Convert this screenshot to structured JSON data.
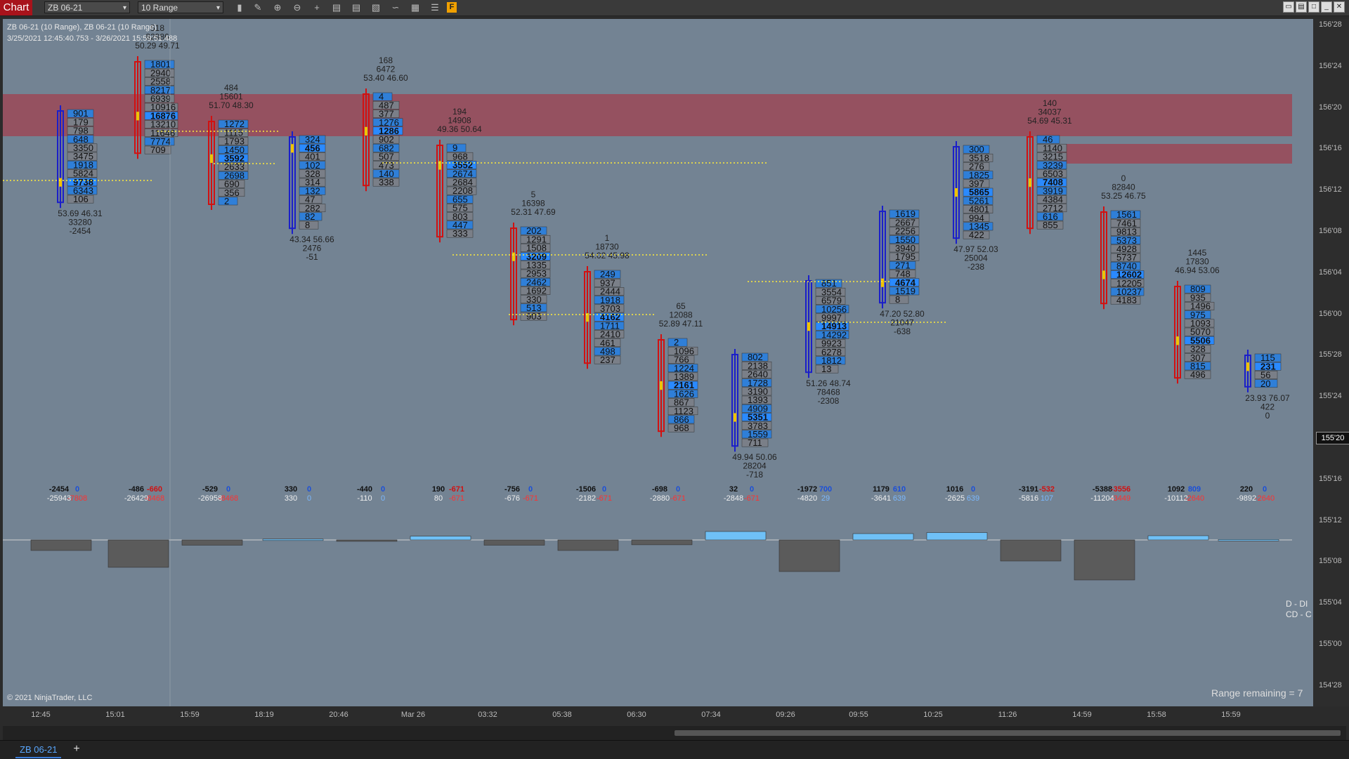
{
  "app": {
    "badge": "Chart"
  },
  "toolbar": {
    "instrument": "ZB 06-21",
    "interval": "10 Range",
    "icons": [
      "bar-type-icon",
      "draw-tool-icon",
      "zoom-in-icon",
      "zoom-out-icon",
      "crosshair-icon",
      "properties-icon",
      "templates-icon",
      "strategy-icon",
      "indicator-icon",
      "chart-trader-icon",
      "data-box-icon",
      "f-icon"
    ],
    "f_label": "F"
  },
  "window_controls": [
    "restore",
    "tile",
    "maximize",
    "minimize",
    "close"
  ],
  "chart": {
    "title": "ZB 06-21 (10 Range), ZB 06-21 (10 Range)",
    "range": "3/25/2021 12:45:40.753 - 3/26/2021 15:59:51.488",
    "copyright": "© 2021 NinjaTrader, LLC",
    "range_remaining": "Range remaining = 7",
    "delta_labels": [
      "D - DI",
      "CD - C"
    ],
    "colors": {
      "background": "#738393",
      "zone": "#a0404f",
      "up_candle": "#1b1fc9",
      "down_candle": "#d11111",
      "vpoc": "#2a8aff",
      "poc_text": "#ffffff",
      "level_line": "#ffeb3b"
    }
  },
  "price_axis": [
    "156'28",
    "156'24",
    "156'20",
    "156'16",
    "156'12",
    "156'08",
    "156'04",
    "156'00",
    "155'28",
    "155'24",
    "155'20",
    "155'16",
    "155'12",
    "155'08",
    "155'04",
    "155'00",
    "154'28"
  ],
  "cursor_price": "155'20",
  "time_axis": [
    "12:45",
    "15:01",
    "15:59",
    "18:19",
    "20:46",
    "Mar 26",
    "03:32",
    "05:38",
    "06:30",
    "07:34",
    "09:26",
    "09:55",
    "10:25",
    "11:26",
    "14:59",
    "15:58",
    "15:59"
  ],
  "tab": {
    "label": "ZB 06-21",
    "add_label": "+"
  },
  "bars": [
    {
      "hdr": [
        "",
        "",
        ""
      ],
      "vols": [
        "901",
        "179",
        "798",
        "648",
        "3350",
        "3475",
        "1918",
        "5824",
        "9738",
        "6343",
        "106"
      ],
      "poc": 8,
      "ftr": [
        "53.69  46.31",
        "33280",
        "-2454"
      ],
      "up": true
    },
    {
      "hdr": [
        "518",
        "82986",
        "50.29  49.71"
      ],
      "vols": [
        "1801",
        "2940",
        "2558",
        "8217",
        "6939",
        "10916",
        "16876",
        "13210",
        "11646",
        "7774",
        "709"
      ],
      "poc": 6,
      "ftr": [
        "",
        "",
        ""
      ],
      "up": false
    },
    {
      "hdr": [
        "484",
        "15601",
        "51.70  48.30"
      ],
      "vols": [
        "1272",
        "1115",
        "1793",
        "1450",
        "3592",
        "2633",
        "2698",
        "690",
        "356",
        "2"
      ],
      "poc": 4,
      "ftr": [
        "",
        "",
        ""
      ],
      "up": false
    },
    {
      "hdr": [
        "",
        "",
        ""
      ],
      "vols": [
        "324",
        "456",
        "401",
        "102",
        "328",
        "314",
        "132",
        "47",
        "282",
        "82",
        "8"
      ],
      "poc": 1,
      "ftr": [
        "43.34  56.66",
        "2476",
        "-51"
      ],
      "up": true
    },
    {
      "hdr": [
        "168",
        "6472",
        "53.40  46.60"
      ],
      "vols": [
        "4",
        "487",
        "377",
        "1276",
        "1286",
        "902",
        "682",
        "507",
        "473",
        "140",
        "338"
      ],
      "poc": 4,
      "ftr": [
        "",
        "",
        ""
      ],
      "up": false
    },
    {
      "hdr": [
        "194",
        "14908",
        "49.36  50.64"
      ],
      "vols": [
        "9",
        "968",
        "3552",
        "2674",
        "2684",
        "2208",
        "655",
        "575",
        "803",
        "447",
        "333"
      ],
      "poc": 2,
      "ftr": [
        "",
        "",
        ""
      ],
      "up": false
    },
    {
      "hdr": [
        "5",
        "16398",
        "52.31  47.69"
      ],
      "vols": [
        "202",
        "1291",
        "1508",
        "3209",
        "1335",
        "2953",
        "2462",
        "1692",
        "330",
        "513",
        "903"
      ],
      "poc": 3,
      "ftr": [
        "",
        "",
        ""
      ],
      "up": false
    },
    {
      "hdr": [
        "1",
        "18730",
        "54.02  45.98"
      ],
      "vols": [
        "249",
        "937",
        "2444",
        "1918",
        "3703",
        "4162",
        "1711",
        "2410",
        "461",
        "498",
        "237"
      ],
      "poc": 5,
      "ftr": [
        "",
        "",
        ""
      ],
      "up": false
    },
    {
      "hdr": [
        "65",
        "12088",
        "52.89  47.11"
      ],
      "vols": [
        "2",
        "1096",
        "766",
        "1224",
        "1389",
        "2161",
        "1626",
        "867",
        "1123",
        "866",
        "968"
      ],
      "poc": 5,
      "ftr": [
        "",
        "",
        ""
      ],
      "up": false
    },
    {
      "hdr": [
        "",
        "",
        ""
      ],
      "vols": [
        "802",
        "2138",
        "2640",
        "1728",
        "3190",
        "1393",
        "4909",
        "5351",
        "3783",
        "1559",
        "711"
      ],
      "poc": 7,
      "ftr": [
        "49.94  50.06",
        "28204",
        "-718"
      ],
      "up": true
    },
    {
      "hdr": [
        "",
        "",
        ""
      ],
      "vols": [
        "851",
        "3554",
        "6579",
        "10256",
        "9997",
        "14913",
        "14292",
        "9923",
        "6278",
        "1812",
        "13"
      ],
      "poc": 5,
      "ftr": [
        "51.26  48.74",
        "78468",
        "-2308"
      ],
      "up": true
    },
    {
      "hdr": [
        "",
        "",
        ""
      ],
      "vols": [
        "1619",
        "2667",
        "2256",
        "1550",
        "3940",
        "1795",
        "271",
        "748",
        "4674",
        "1519",
        "8"
      ],
      "poc": 8,
      "ftr": [
        "47.20  52.80",
        "21047",
        "-638"
      ],
      "up": true
    },
    {
      "hdr": [
        "",
        "",
        ""
      ],
      "vols": [
        "300",
        "3518",
        "276",
        "1825",
        "397",
        "5865",
        "5261",
        "4801",
        "994",
        "1345",
        "422"
      ],
      "poc": 5,
      "ftr": [
        "47.97  52.03",
        "25004",
        "-238"
      ],
      "up": true
    },
    {
      "hdr": [
        "140",
        "34037",
        "54.69  45.31"
      ],
      "vols": [
        "46",
        "1140",
        "3215",
        "3239",
        "6503",
        "7408",
        "3919",
        "4384",
        "2712",
        "616",
        "855"
      ],
      "poc": 5,
      "ftr": [
        "",
        "",
        ""
      ],
      "up": false
    },
    {
      "hdr": [
        "0",
        "82840",
        "53.25  46.75"
      ],
      "vols": [
        "1561",
        "7461",
        "9813",
        "5373",
        "4928",
        "5737",
        "8740",
        "12602",
        "12205",
        "10237",
        "4183"
      ],
      "poc": 7,
      "ftr": [
        "",
        "",
        ""
      ],
      "up": false
    },
    {
      "hdr": [
        "1445",
        "17830",
        "46.94  53.06"
      ],
      "vols": [
        "809",
        "935",
        "1496",
        "975",
        "1093",
        "5070",
        "5506",
        "328",
        "307",
        "815",
        "496"
      ],
      "poc": 6,
      "ftr": [
        "",
        "",
        ""
      ],
      "up": false
    },
    {
      "hdr": [
        "",
        "",
        ""
      ],
      "vols": [
        "115",
        "231",
        "56",
        "20"
      ],
      "poc": 1,
      "ftr": [
        "23.93  76.07",
        "422",
        "0"
      ],
      "up": true
    }
  ],
  "delta": [
    {
      "d": "-2454",
      "di": "0",
      "cd": "-25943",
      "c": "-7808",
      "val": -0.5
    },
    {
      "d": "-486",
      "di": "-660",
      "cd": "-26429",
      "c": "-8468",
      "val": -1.3
    },
    {
      "d": "-529",
      "di": "0",
      "cd": "-26958",
      "c": "-8468",
      "val": -0.25
    },
    {
      "d": "330",
      "di": "0",
      "cd": "330",
      "c": "0",
      "val": 0.04
    },
    {
      "d": "-440",
      "di": "0",
      "cd": "-110",
      "c": "0",
      "val": -0.06
    },
    {
      "d": "190",
      "di": "-671",
      "cd": "80",
      "c": "-671",
      "val": 0.18
    },
    {
      "d": "-756",
      "di": "0",
      "cd": "-676",
      "c": "-671",
      "val": -0.25
    },
    {
      "d": "-1506",
      "di": "0",
      "cd": "-2182",
      "c": "-671",
      "val": -0.5
    },
    {
      "d": "-698",
      "di": "0",
      "cd": "-2880",
      "c": "-671",
      "val": -0.23
    },
    {
      "d": "32",
      "di": "0",
      "cd": "-2848",
      "c": "-671",
      "val": 0.4
    },
    {
      "d": "-1972",
      "di": "700",
      "cd": "-4820",
      "c": "29",
      "val": -1.5
    },
    {
      "d": "1179",
      "di": "610",
      "cd": "-3641",
      "c": "639",
      "val": 0.3
    },
    {
      "d": "1016",
      "di": "0",
      "cd": "-2625",
      "c": "639",
      "val": 0.35
    },
    {
      "d": "-3191",
      "di": "-532",
      "cd": "-5816",
      "c": "107",
      "val": -1.0
    },
    {
      "d": "-5388",
      "di": "-3556",
      "cd": "-11204",
      "c": "-3449",
      "val": -1.9
    },
    {
      "d": "1092",
      "di": "809",
      "cd": "-10112",
      "c": "-2640",
      "val": 0.2
    },
    {
      "d": "220",
      "di": "0",
      "cd": "-9892",
      "c": "-2640",
      "val": 0.02
    }
  ]
}
